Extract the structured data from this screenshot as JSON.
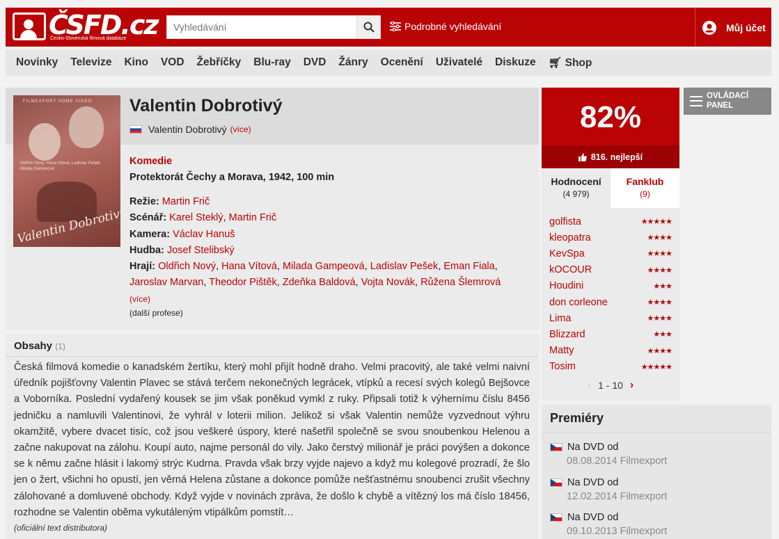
{
  "header": {
    "logo_text": "ČSFD.cz",
    "logo_sub": "Česko-Slovenská filmová databáze",
    "search_placeholder": "Vyhledávání",
    "advanced_search": "Podrobné vyhledávání",
    "account": "Můj účet"
  },
  "nav": [
    "Novinky",
    "Televize",
    "Kino",
    "VOD",
    "Žebříčky",
    "Blu-ray",
    "DVD",
    "Žánry",
    "Ocenění",
    "Uživatelé",
    "Diskuze",
    "Shop"
  ],
  "film": {
    "title": "Valentin Dobrotivý",
    "alt_title": "Valentin Dobrotivý",
    "alt_more": "(více)",
    "genre": "Komedie",
    "origin": "Protektorát Čechy a Morava, 1942, 100 min",
    "poster": {
      "top": "FILMEXPORT HOME VIDEO",
      "names": "Oldřich Nový, Hana Vítová, Ladislav Pešek, Milada Gampeová",
      "title": "Valentin Dobrotivý"
    },
    "credits": {
      "directing_label": "Režie:",
      "directing": [
        "Martin Frič"
      ],
      "writing_label": "Scénář:",
      "writing": [
        "Karel Steklý",
        "Martin Frič"
      ],
      "camera_label": "Kamera:",
      "camera": [
        "Václav Hanuš"
      ],
      "music_label": "Hudba:",
      "music": [
        "Josef Stelibský"
      ],
      "cast_label": "Hrají:",
      "cast": [
        "Oldřich Nový",
        "Hana Vítová",
        "Milada Gampeová",
        "Ladislav Pešek",
        "Eman Fiala",
        "Jaroslav Marvan",
        "Theodor Pištěk",
        "Zdeňka Baldová",
        "Vojta Novák",
        "Růžena Šlemrová"
      ],
      "cast_more": "(více)"
    },
    "more_professions": "(další profese)"
  },
  "plot": {
    "heading": "Obsahy",
    "count": "(1)",
    "text": "Česká filmová komedie o kanadském žertíku, který mohl přijít hodně draho. Velmi pracovitý, ale také velmi naivní úředník pojišťovny Valentin Plavec se stává terčem nekonečných legrácek, vtípků a recesí svých kolegů Bejšovce a Voborníka. Poslední vydařený kousek se jim však poněkud vymkl z ruky. Připsali totiž k výhernímu číslu 8456 jedničku a namluvili Valentinovi, že vyhrál v loterii milion. Jelikož si však Valentin nemůže vyzvednout výhru okamžitě, vybere dvacet tisíc, což jsou veškeré úspory, které našetřil společně se svou snoubenkou Helenou a začne nakupovat na zálohu. Koupí auto, najme personál do vily. Jako čerstvý milionář je práci povýšen a dokonce se k němu začne hlásit i lakomý strýc Kudrna. Pravda však brzy vyjde najevo a když mu kolegové prozradí, že šlo jen o žert, všichni ho opustí, jen věrná Helena zůstane a dokonce pomůže nešťastnému snoubenci zrušit všechny zálohované a domluvené obchody. Když vyjde v novinách zpráva, že došlo k chybě a vítězný los má číslo 18456, rozhodne se Valentin oběma vykutáleným vtipálkům pomstít…",
    "source": "(oficiální text distributora)"
  },
  "rating": {
    "percent": "82%",
    "rank": "816. nejlepší",
    "tab_ratings": "Hodnocení",
    "tab_ratings_count": "(4 979)",
    "tab_fanclub": "Fanklub",
    "tab_fanclub_count": "(9)",
    "users": [
      {
        "name": "golfista",
        "stars": 5
      },
      {
        "name": "kleopatra",
        "stars": 4
      },
      {
        "name": "KevSpa",
        "stars": 4
      },
      {
        "name": "kOCOUR",
        "stars": 4
      },
      {
        "name": "Houdini",
        "stars": 3
      },
      {
        "name": "don corleone",
        "stars": 4
      },
      {
        "name": "Lima",
        "stars": 4
      },
      {
        "name": "Blizzard",
        "stars": 3
      },
      {
        "name": "Matty",
        "stars": 4
      },
      {
        "name": "Tosim",
        "stars": 5
      }
    ],
    "pager": "1 - 10"
  },
  "control_panel": "OVLÁDACÍ PANEL",
  "premieres": {
    "heading": "Premiéry",
    "items": [
      {
        "label": "Na DVD od",
        "detail": "08.08.2014 Filmexport"
      },
      {
        "label": "Na DVD od",
        "detail": "12.02.2014 Filmexport"
      },
      {
        "label": "Na DVD od",
        "detail": "09.10.2013 Filmexport"
      }
    ]
  },
  "colors": {
    "brand": "#ba0305",
    "brand_dark": "#9c0204"
  }
}
